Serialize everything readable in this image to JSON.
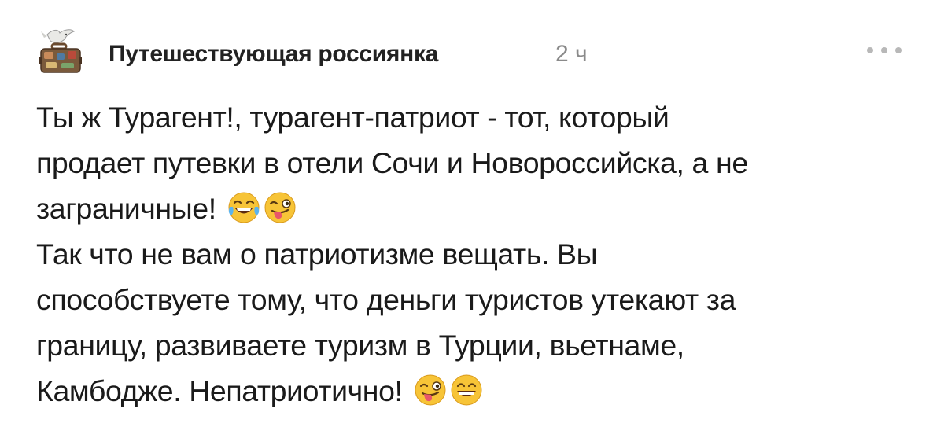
{
  "comment": {
    "author": "Путешествующая россиянка",
    "time": "2 ч",
    "avatar_icon": "dove-suitcase-avatar",
    "more_icon": "more-dots-icon",
    "lines": [
      "Ты ж Турагент!, турагент-патриот - тот, который",
      "продает путевки в отели Сочи и Новороссийска, а не",
      "заграничные!",
      "Так что не вам о патриотизме вещать. Вы",
      "способствуете тому, что деньги туристов утекают за",
      "границу, развиваете туризм в Турции, вьетнаме,",
      "Камбодже. Непатриотично!"
    ],
    "emojis": {
      "line3": [
        "laughing-tears-emoji",
        "winking-tongue-emoji"
      ],
      "line7": [
        "winking-tongue-emoji",
        "grinning-emoji"
      ]
    }
  },
  "colors": {
    "text": "#1a1a1a",
    "muted": "#8a8a8a",
    "dots": "#b8b8b8",
    "emoji_yellow": "#f7c437"
  }
}
